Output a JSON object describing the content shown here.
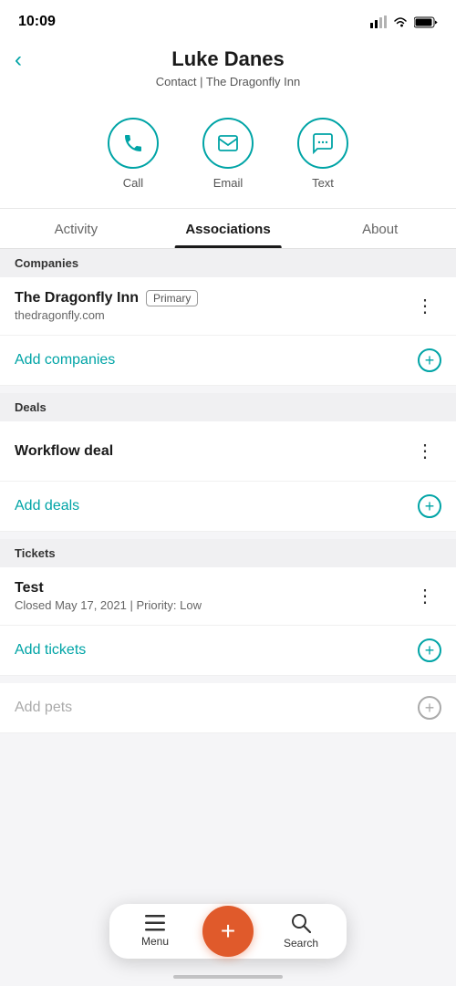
{
  "statusBar": {
    "time": "10:09"
  },
  "header": {
    "backLabel": "‹",
    "contactName": "Luke Danes",
    "subtitle": "Contact | The Dragonfly Inn"
  },
  "actions": [
    {
      "id": "call",
      "label": "Call"
    },
    {
      "id": "email",
      "label": "Email"
    },
    {
      "id": "text",
      "label": "Text"
    }
  ],
  "tabs": [
    {
      "id": "activity",
      "label": "Activity",
      "active": false
    },
    {
      "id": "associations",
      "label": "Associations",
      "active": true
    },
    {
      "id": "about",
      "label": "About",
      "active": false
    }
  ],
  "sections": {
    "companies": {
      "header": "Companies",
      "items": [
        {
          "name": "The Dragonfly Inn",
          "badge": "Primary",
          "url": "thedragonfly.com"
        }
      ],
      "addLabel": "Add companies"
    },
    "deals": {
      "header": "Deals",
      "items": [
        {
          "name": "Workflow deal"
        }
      ],
      "addLabel": "Add deals"
    },
    "tickets": {
      "header": "Tickets",
      "items": [
        {
          "name": "Test",
          "meta": "Closed May 17, 2021 | Priority: Low"
        }
      ],
      "addLabel": "Add tickets"
    },
    "pets": {
      "addLabel": "Add pets",
      "muted": true
    }
  },
  "bottomNav": {
    "menuLabel": "Menu",
    "searchLabel": "Search"
  }
}
